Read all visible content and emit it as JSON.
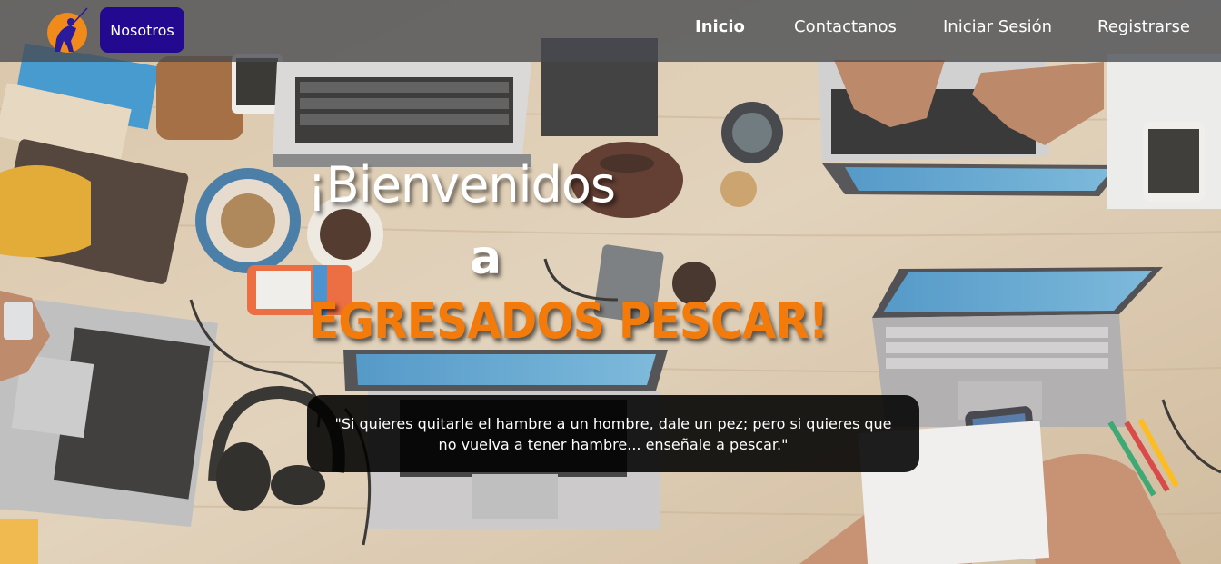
{
  "nav": {
    "brand_button": "Nosotros",
    "links": [
      {
        "label": "Inicio",
        "active": true
      },
      {
        "label": "Contactanos",
        "active": false
      },
      {
        "label": "Iniciar Sesión",
        "active": false
      },
      {
        "label": "Registrarse",
        "active": false
      }
    ]
  },
  "hero": {
    "line1": "¡Bienvenidos",
    "line2": "a",
    "line3": "EGRESADOS PESCAR!",
    "quote": "\"Si quieres quitarle el hambre a un hombre, dale un pez; pero si quieres que no vuelva a tener hambre... enseñale a pescar.\""
  },
  "colors": {
    "nav_bg": "#464a50",
    "brand_button_bg": "#22098f",
    "accent_orange": "#f27b0c",
    "logo_orange": "#f08a1a",
    "logo_figure": "#2a1b9c"
  },
  "icons": {
    "logo": "fisherman-logo-icon"
  }
}
